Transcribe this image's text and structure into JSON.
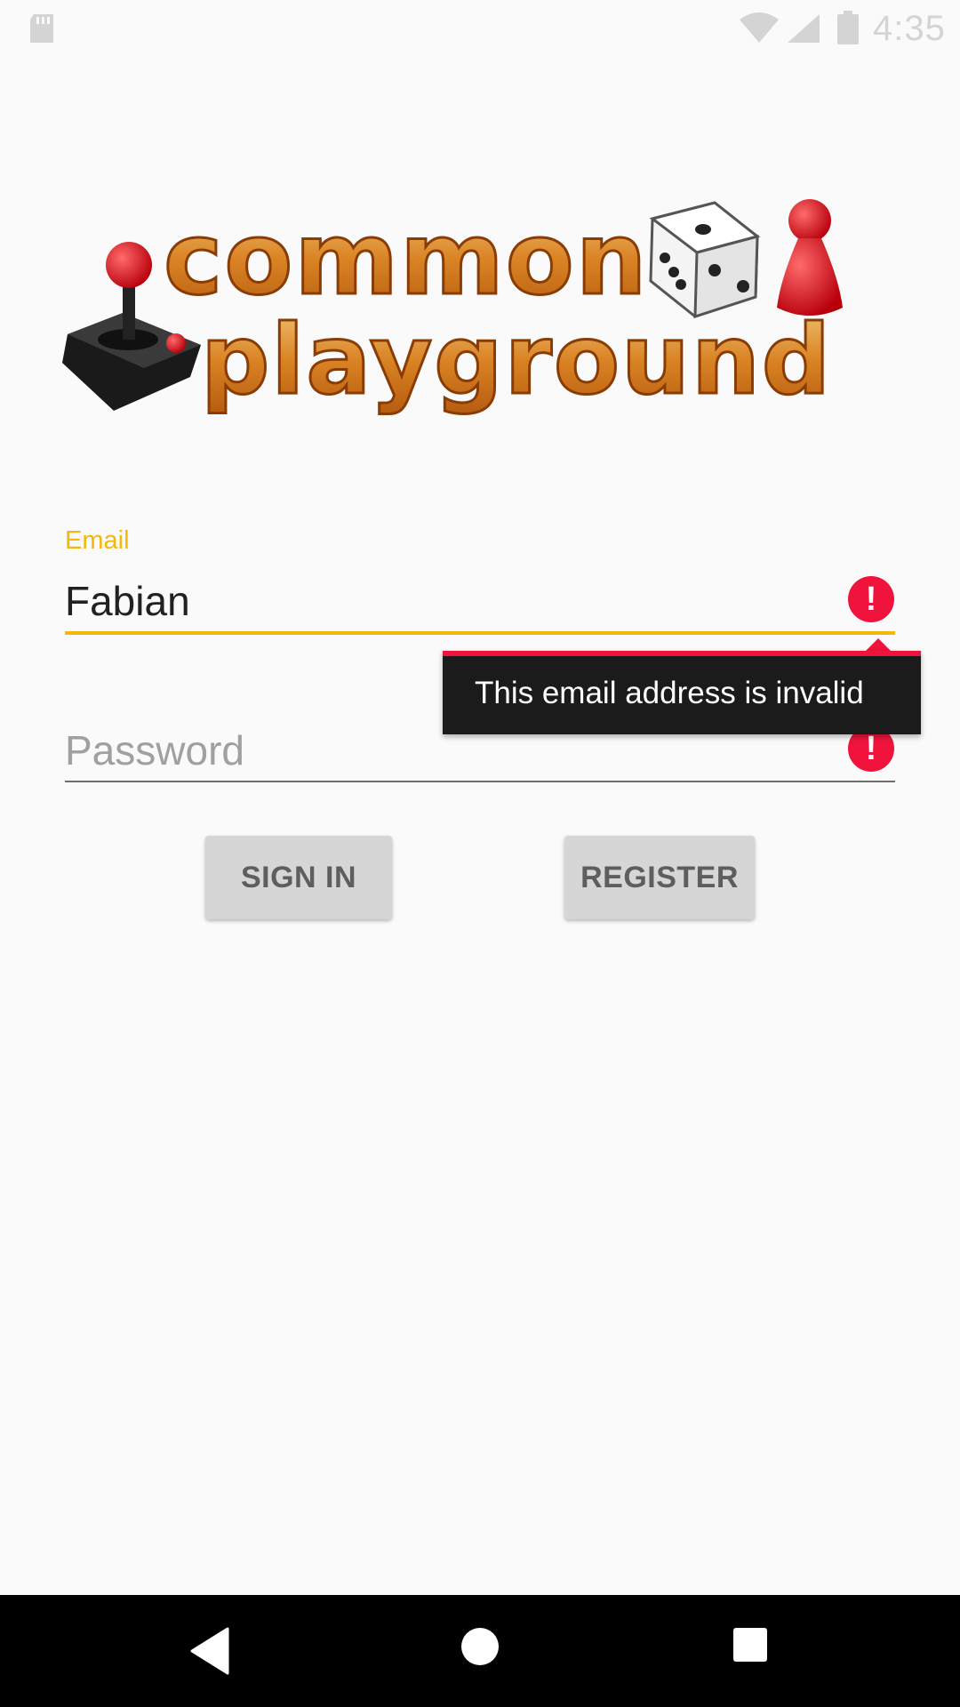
{
  "status_bar": {
    "time": "4:35",
    "icons": [
      "sd-card-icon",
      "wifi-icon",
      "signal-icon",
      "battery-icon"
    ]
  },
  "logo": {
    "line1": "common",
    "line2": "playground",
    "graphics": [
      "joystick-icon",
      "dice-icon",
      "game-pawn-icon"
    ]
  },
  "login_form": {
    "email": {
      "label": "Email",
      "value": "Fabian"
    },
    "password": {
      "placeholder": "Password",
      "value": ""
    },
    "error_tooltip": "This email address is invalid",
    "error_icon": "!"
  },
  "buttons": {
    "sign_in": "SIGN IN",
    "register": "REGISTER"
  },
  "nav_bar": {
    "icons": [
      "back-icon",
      "home-icon",
      "recent-apps-icon"
    ]
  },
  "colors": {
    "accent": "#f5b70b",
    "error": "#f0143c",
    "tooltip_bg": "#1b1b1b",
    "button_bg": "#d6d6d6",
    "background": "#fafafa"
  }
}
